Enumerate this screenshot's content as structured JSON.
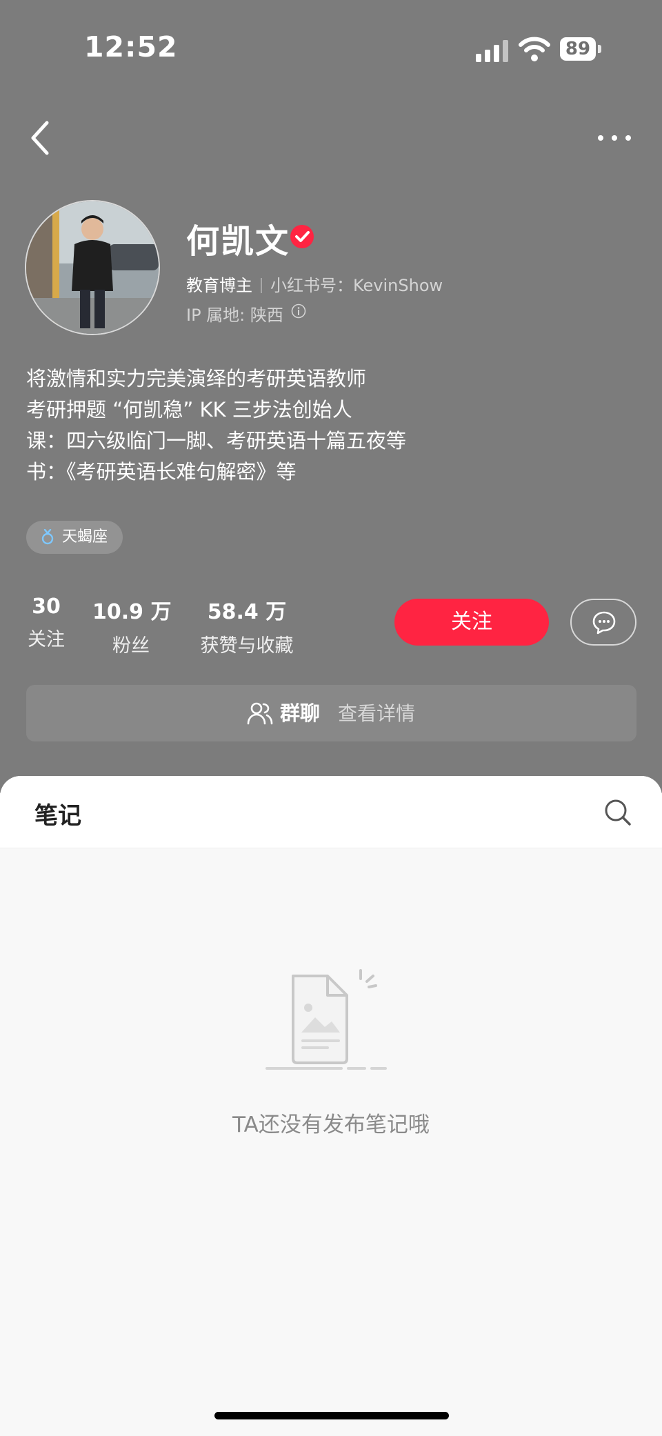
{
  "status_bar": {
    "time": "12:52",
    "battery": "89"
  },
  "profile": {
    "name": "何凯文",
    "role": "教育博主",
    "id_label": "小红书号：KevinShow",
    "ip": "IP 属地: 陕西",
    "bio": [
      "将激情和实力完美演绎的考研英语教师",
      "考研押题 “何凯稳” KK 三步法创始人",
      "课：四六级临门一脚、考研英语十篇五夜等",
      "书：《考研英语长难句解密》等"
    ],
    "tag": "天蝎座"
  },
  "stats": [
    {
      "value": "30",
      "label": "关注"
    },
    {
      "value": "10.9 万",
      "label": "粉丝"
    },
    {
      "value": "58.4 万",
      "label": "获赞与收藏"
    }
  ],
  "actions": {
    "follow": "关注"
  },
  "group_chat": {
    "title": "群聊",
    "detail": "查看详情"
  },
  "notes": {
    "tab": "笔记",
    "empty_text": "TA还没有发布笔记哦"
  },
  "colors": {
    "accent": "#ff2442",
    "header_bg": "#7c7c7c",
    "content_bg": "#f8f8f8"
  },
  "icons": [
    "back-icon",
    "more-icon",
    "verified-icon",
    "info-icon",
    "female-icon",
    "chat-bubble-icon",
    "group-icon",
    "search-icon",
    "empty-notes-illustration"
  ]
}
